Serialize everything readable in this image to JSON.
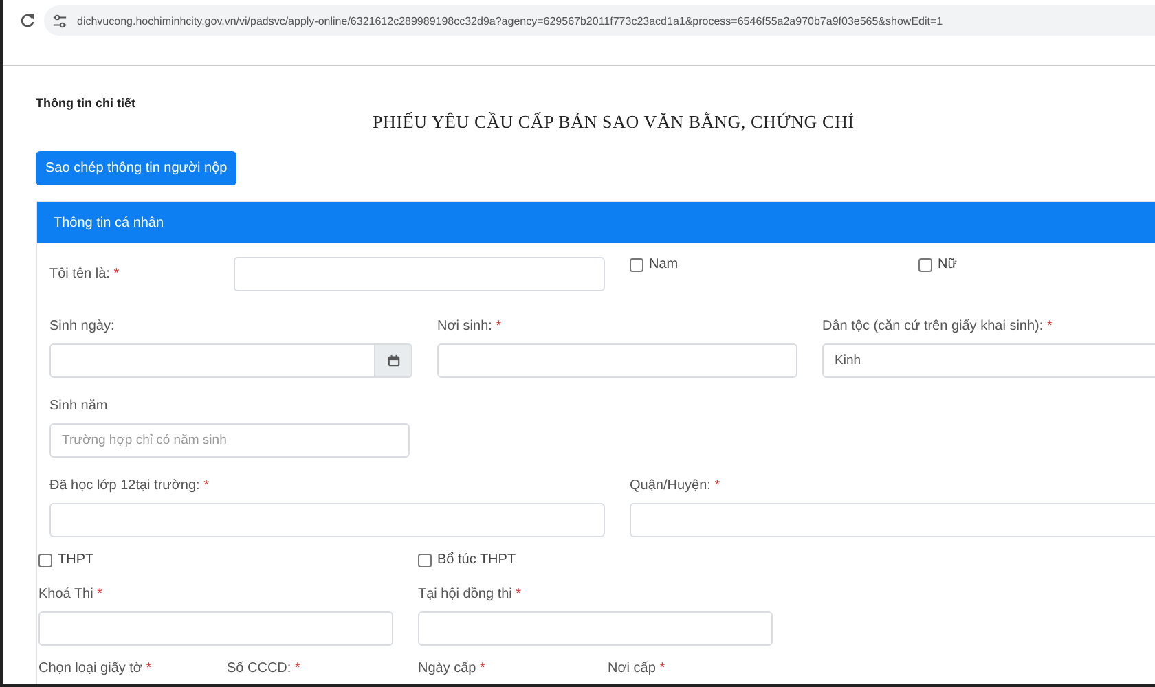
{
  "browser": {
    "url": "dichvucong.hochiminhcity.gov.vn/vi/padsvc/apply-online/6321612c289989198cc32d9a?agency=629567b2011f773c23acd1a1&process=6546f55a2a970b7a9f03e565&showEdit=1"
  },
  "page": {
    "section_title": "Thông tin chi tiết",
    "form_title": "PHIẾU YÊU CẦU CẤP BẢN SAO VĂN BẰNG, CHỨNG CHỈ",
    "copy_button": "Sao chép thông tin người nộp"
  },
  "panel": {
    "title": "Thông tin cá nhân",
    "rows": [
      [
        {
          "kind": "inline_field",
          "label": "Tôi tên là:",
          "required_mark": "*"
        },
        {
          "kind": "checkbox",
          "label": "Nam",
          "checked": false
        },
        {
          "kind": "checkbox",
          "label": "Nữ",
          "checked": false
        }
      ],
      [
        {
          "kind": "date_field",
          "label": "Sinh ngày:"
        },
        {
          "kind": "field",
          "label": "Nơi sinh:",
          "required_mark": "*"
        },
        {
          "kind": "select",
          "label": "Dân tộc (căn cứ trên giấy khai sinh):",
          "required_mark": "*",
          "value": "Kinh"
        }
      ],
      [
        {
          "kind": "field",
          "label": "Sinh năm",
          "placeholder": "Trường hợp chỉ có năm sinh"
        }
      ],
      [
        {
          "kind": "field",
          "label": "Đã học lớp 12tại trường:",
          "required_mark": "*"
        },
        {
          "kind": "field",
          "label": "Quận/Huyện:",
          "required_mark": "*"
        }
      ]
    ],
    "exam_rows": [
      [
        {
          "kind": "checkbox",
          "label": "THPT",
          "checked": false
        },
        {
          "kind": "checkbox",
          "label": "Bổ túc THPT",
          "checked": false
        }
      ],
      [
        {
          "kind": "field",
          "label": "Khoá Thi",
          "required_mark": "*"
        },
        {
          "kind": "field",
          "label": "Tại hội đồng thi",
          "required_mark": "*"
        }
      ],
      [
        {
          "kind": "label",
          "label": "Chọn loại giấy tờ",
          "required_mark": "*"
        },
        {
          "kind": "label",
          "label": "Số CCCD:",
          "required_mark": "*"
        },
        {
          "kind": "label",
          "label": "Ngày cấp",
          "required_mark": "*"
        },
        {
          "kind": "label",
          "label": "Nơi cấp",
          "required_mark": "*"
        }
      ]
    ]
  }
}
